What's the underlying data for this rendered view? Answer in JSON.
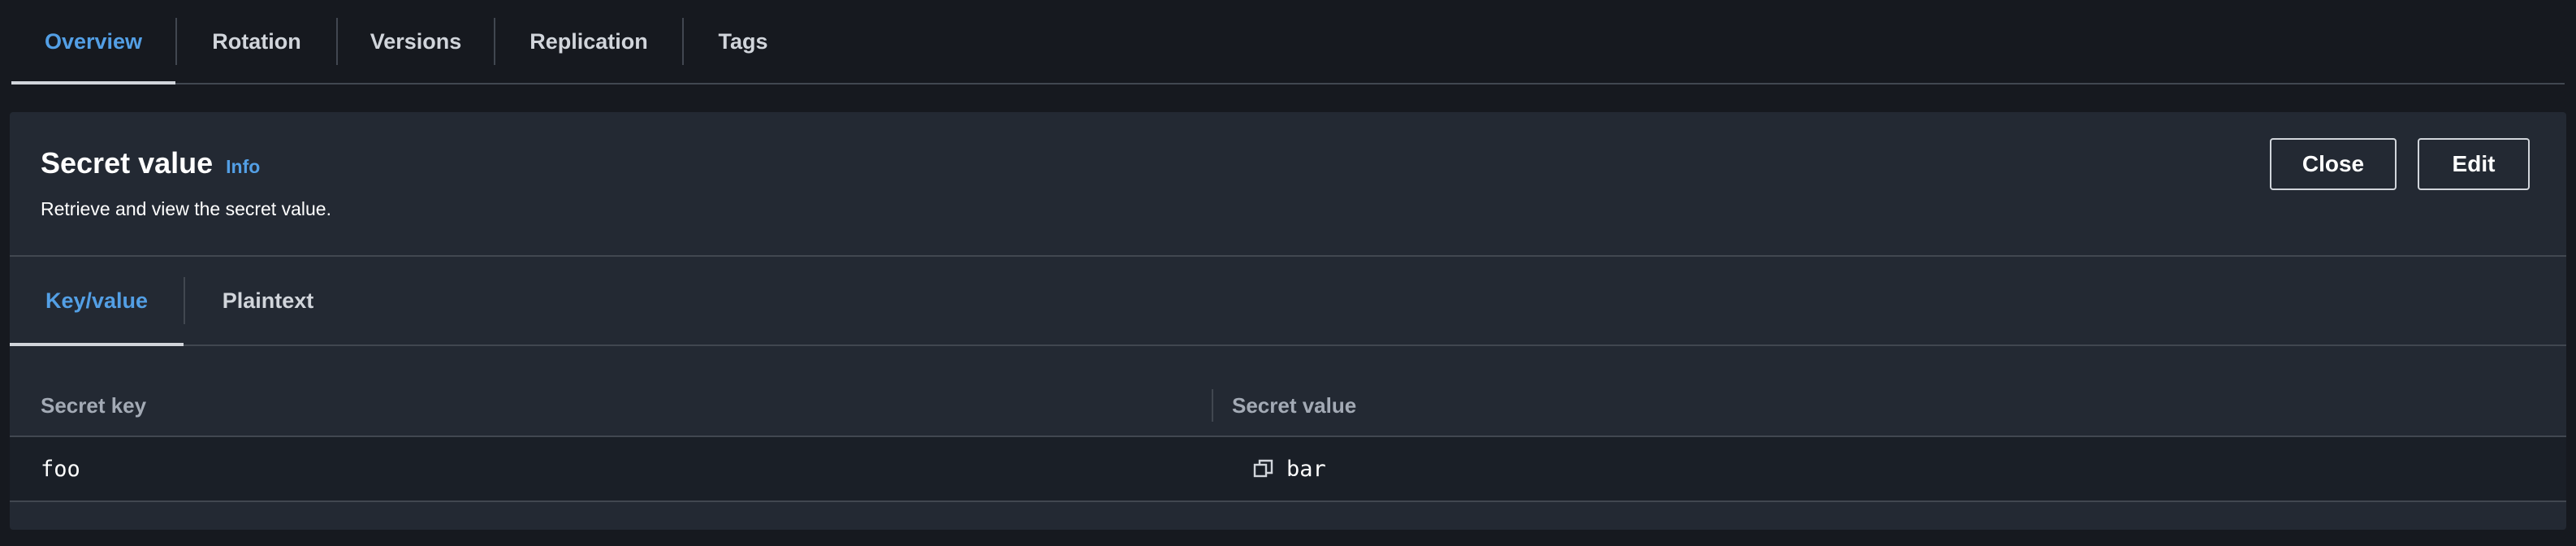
{
  "top_tabs": [
    {
      "label": "Overview",
      "active": true
    },
    {
      "label": "Rotation",
      "active": false
    },
    {
      "label": "Versions",
      "active": false
    },
    {
      "label": "Replication",
      "active": false
    },
    {
      "label": "Tags",
      "active": false
    }
  ],
  "panel": {
    "title": "Secret value",
    "info_link": "Info",
    "description": "Retrieve and view the secret value.",
    "close_label": "Close",
    "edit_label": "Edit"
  },
  "inner_tabs": [
    {
      "label": "Key/value",
      "active": true
    },
    {
      "label": "Plaintext",
      "active": false
    }
  ],
  "table": {
    "columns": [
      "Secret key",
      "Secret value"
    ],
    "rows": [
      {
        "key": "foo",
        "value": "bar",
        "icon": "copy-icon"
      }
    ]
  },
  "colors": {
    "accent": "#539fe5",
    "background": "#16191f",
    "panel": "#232933",
    "row": "#1a1f27",
    "border": "#414750"
  }
}
